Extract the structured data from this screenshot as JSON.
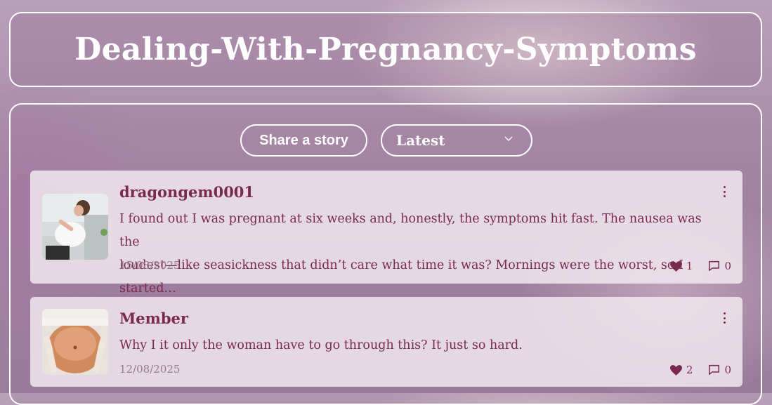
{
  "header": {
    "title": "Dealing-With-Pregnancy-Symptoms"
  },
  "toolbar": {
    "share_label": "Share a story",
    "sort_selected": "Latest"
  },
  "posts": [
    {
      "author": "dragongem0001",
      "excerpt_line1": "I found out I was pregnant at six weeks and, honestly, the symptoms hit fast. The nausea was the",
      "excerpt_line2": "loudest—like seasickness that didn’t care what time it was? Mornings were the worst, so I started…",
      "date": "15/08/2025",
      "likes": "1",
      "comments": "0"
    },
    {
      "author": "Member",
      "excerpt_line1": "Why I it only the woman have to go through this? It just so hard.",
      "date": "12/08/2025",
      "likes": "2",
      "comments": "0"
    }
  ],
  "colors": {
    "accent": "#7a2a4f",
    "card_bg": "#efe7ed",
    "white": "#ffffff"
  }
}
